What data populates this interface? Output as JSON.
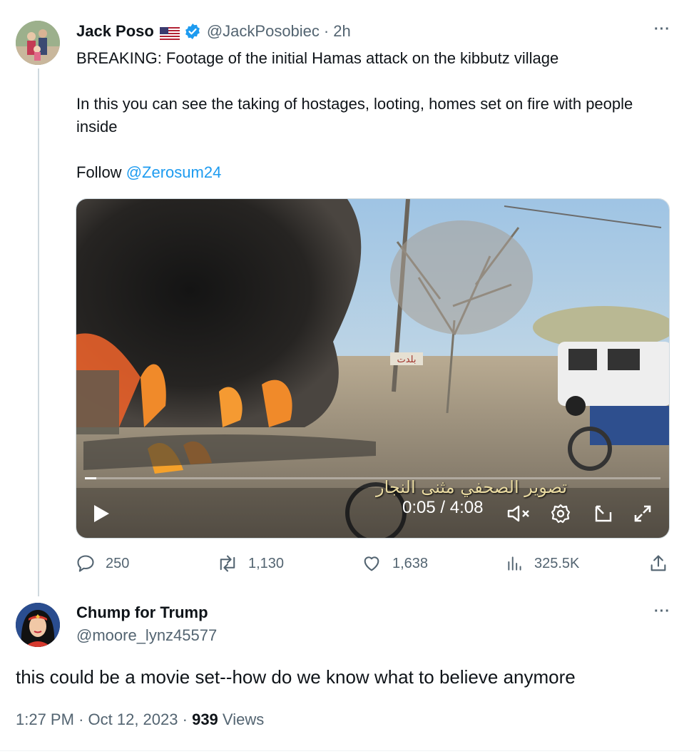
{
  "tweet": {
    "author_name": "Jack Poso",
    "author_handle": "@JackPosobiec",
    "separator": "·",
    "time": "2h",
    "more_label": "···",
    "lines": [
      "BREAKING: Footage of the initial Hamas attack on the kibbutz village",
      "In this you can see the taking of hostages, looting, homes set on fire with people inside"
    ],
    "follow_prefix": "Follow",
    "follow_mention": "@Zerosum24",
    "video": {
      "current_time": "0:05",
      "duration": "4:08",
      "time_display": "0:05 / 4:08",
      "caption": "تصوير الصحفي مثنى النجار",
      "sign_text": "بلدت",
      "progress": 0.02
    },
    "stats": {
      "replies": "250",
      "reposts": "1,130",
      "likes": "1,638",
      "views": "325.5K"
    }
  },
  "reply": {
    "author_name": "Chump for Trump",
    "author_handle": "@moore_lynz45577",
    "more_label": "···",
    "text": "this could be a movie set--how do we know what to believe anymore",
    "time": "1:27 PM",
    "date": "Oct 12, 2023",
    "separator": "·",
    "views_count": "939",
    "views_label": "Views"
  },
  "colors": {
    "accent": "#1d9bf0",
    "secondary_text": "#536471",
    "primary_text": "#0f1419"
  },
  "icons": [
    "us-flag-icon",
    "verified-badge-icon",
    "reply-icon",
    "repost-icon",
    "like-icon",
    "views-icon",
    "share-icon",
    "play-icon",
    "mute-icon",
    "settings-icon",
    "pip-icon",
    "fullscreen-icon"
  ]
}
